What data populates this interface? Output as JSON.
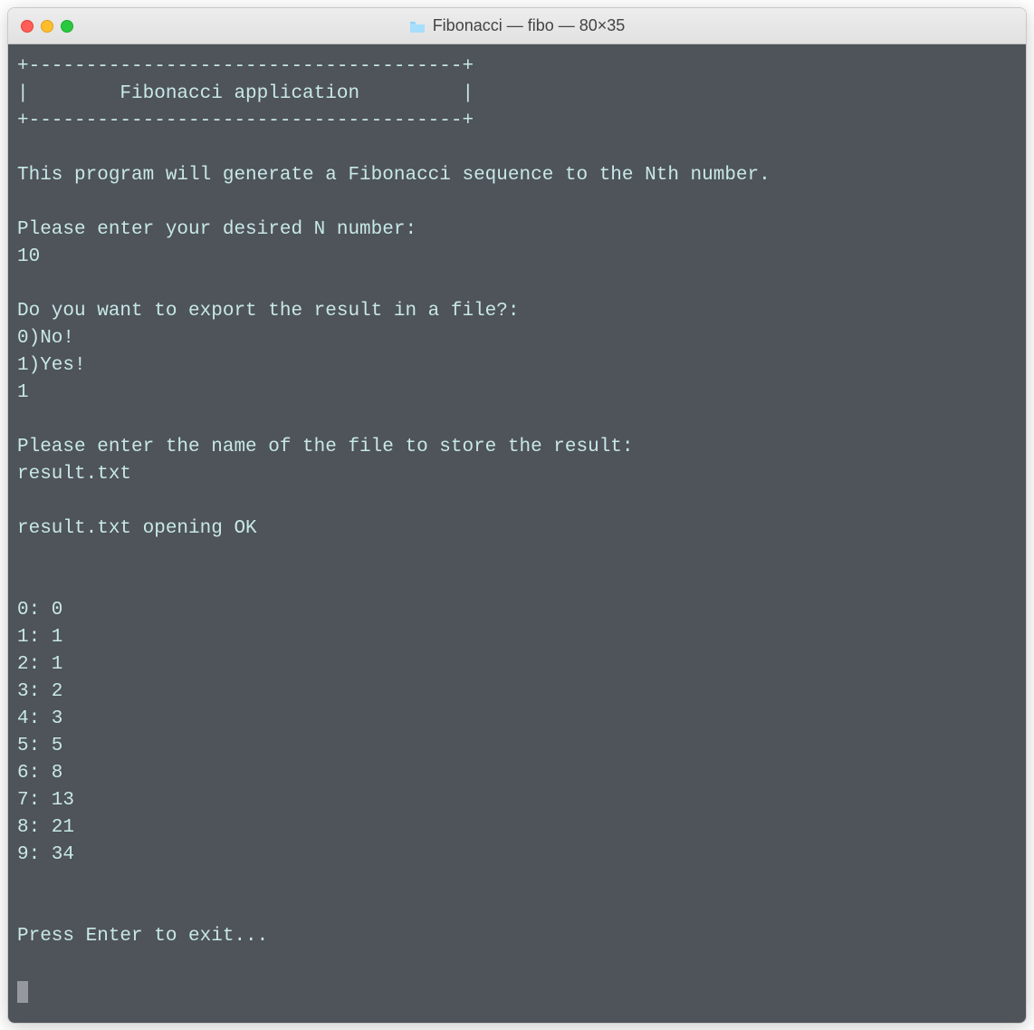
{
  "window": {
    "title": "Fibonacci — fibo — 80×35"
  },
  "terminal": {
    "box_top": "+--------------------------------------+",
    "box_middle": "|        Fibonacci application         |",
    "box_bottom": "+--------------------------------------+",
    "intro": "This program will generate a Fibonacci sequence to the Nth number.",
    "prompt_n": "Please enter your desired N number:",
    "input_n": "10",
    "prompt_export": "Do you want to export the result in a file?:",
    "option_no": "0)No!",
    "option_yes": "1)Yes!",
    "input_export": "1",
    "prompt_filename": "Please enter the name of the file to store the result:",
    "input_filename": "result.txt",
    "file_status": "result.txt opening OK",
    "results": [
      "0: 0",
      "1: 1",
      "2: 1",
      "3: 2",
      "4: 3",
      "5: 5",
      "6: 8",
      "7: 13",
      "8: 21",
      "9: 34"
    ],
    "exit_prompt": "Press Enter to exit..."
  }
}
